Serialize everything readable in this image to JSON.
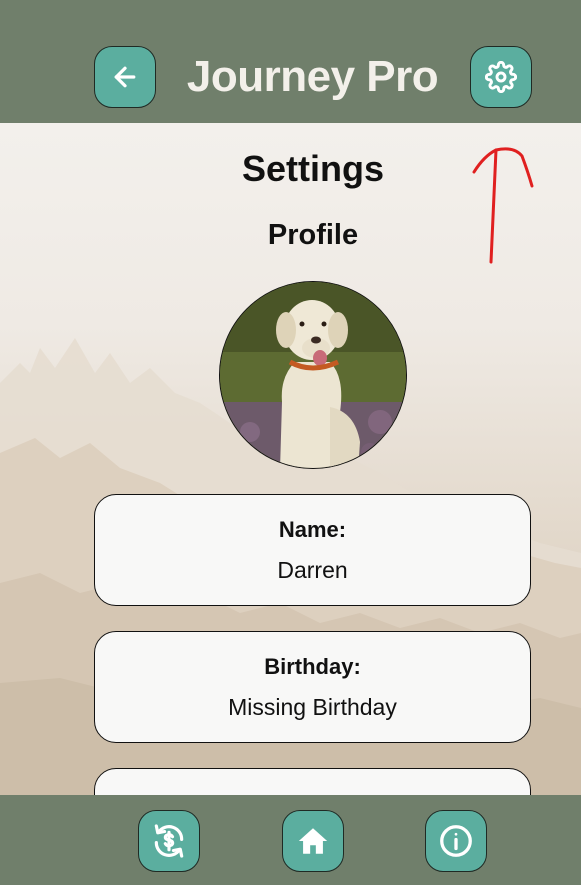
{
  "header": {
    "app_title": "Journey Pro",
    "back_icon": "arrow-left-icon",
    "settings_icon": "gear-icon"
  },
  "main": {
    "page_title": "Settings",
    "section_title": "Profile",
    "avatar_subject": "dog-photo",
    "fields": [
      {
        "label": "Name:",
        "value": "Darren"
      },
      {
        "label": "Birthday:",
        "value": "Missing Birthday"
      },
      {
        "label": "",
        "value": ""
      }
    ]
  },
  "footer": {
    "items": [
      {
        "icon": "sync-dollar-icon"
      },
      {
        "icon": "home-icon"
      },
      {
        "icon": "info-icon"
      }
    ]
  },
  "colors": {
    "bar": "#707f6b",
    "button": "#5bae9f",
    "annotation": "#e02020"
  }
}
